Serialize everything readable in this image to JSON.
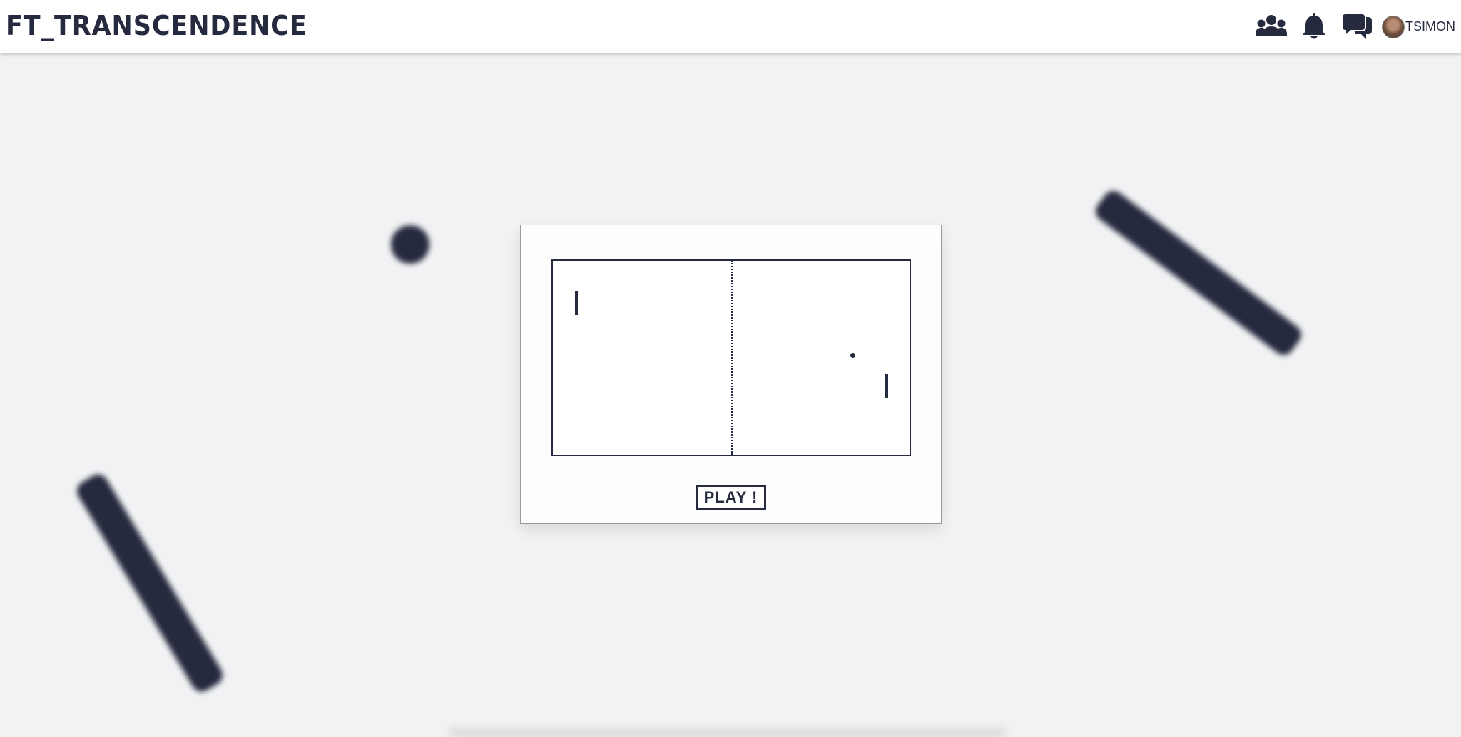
{
  "app": {
    "title": "FT_TRANSCENDENCE"
  },
  "header": {
    "icons": [
      "friends-icon",
      "bell-icon",
      "chat-icon"
    ],
    "user": {
      "username": "TSIMON"
    }
  },
  "game": {
    "play_label": "PLAY !"
  },
  "colors": {
    "primary": "#262a3f",
    "background": "#f1f2f4",
    "surface": "#ffffff"
  }
}
